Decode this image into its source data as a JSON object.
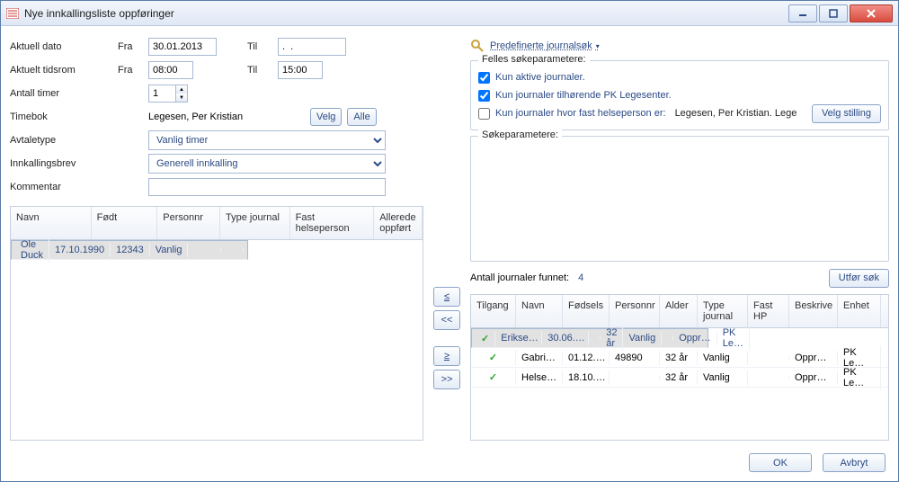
{
  "window": {
    "title": "Nye innkallingsliste oppføringer"
  },
  "form": {
    "aktuell_dato_label": "Aktuell dato",
    "aktuell_tidsrom_label": "Aktuelt tidsrom",
    "antall_timer_label": "Antall timer",
    "timebok_label": "Timebok",
    "avtaletype_label": "Avtaletype",
    "innkallingsbrev_label": "Innkallingsbrev",
    "kommentar_label": "Kommentar",
    "fra_label": "Fra",
    "til_label": "Til",
    "dato_fra": "30.01.2013",
    "dato_til": ".  .",
    "tid_fra": "08:00",
    "tid_til": "15:00",
    "antall_timer": "1",
    "timebok_value": "Legesen, Per Kristian",
    "velg_btn": "Velg",
    "alle_btn": "Alle",
    "avtaletype_value": "Vanlig timer",
    "innkallingsbrev_value": "Generell innkalling",
    "kommentar_value": ""
  },
  "left_table": {
    "headers": {
      "navn": "Navn",
      "fodt": "Født",
      "personnr": "Personnr",
      "type": "Type journal",
      "fastHP": "Fast helseperson",
      "allerede": "Allerede oppført"
    },
    "rows": [
      {
        "navn": "Ole Duck",
        "fodt": "17.10.1990",
        "personnr": "12343",
        "type": "Vanlig",
        "fastHP": "",
        "allerede": ""
      }
    ]
  },
  "mid": {
    "lt": "≤",
    "dlt": "<<",
    "gt": "≥",
    "dgt": ">>"
  },
  "search": {
    "predef_label": "Predefinerte journalsøk",
    "felles_legend": "Felles søkeparametere:",
    "chk_aktive": "Kun aktive journaler.",
    "chk_pk": "Kun journaler tilhørende PK Legesenter.",
    "chk_fast": "Kun journaler hvor fast helseperson er:",
    "fast_person": "Legesen, Per Kristian. Lege",
    "velg_stilling_btn": "Velg stilling",
    "sokeparam_legend": "Søkeparametere:",
    "antall_label": "Antall journaler funnet:",
    "antall_value": "4",
    "utfor_btn": "Utfør søk"
  },
  "results": {
    "headers": {
      "tilgang": "Tilgang",
      "navn": "Navn",
      "fodsels": "Fødsels",
      "personnr": "Personnr",
      "alder": "Alder",
      "type": "Type journal",
      "fastHP": "Fast HP",
      "beskriv": "Beskrive",
      "enhet": "Enhet"
    },
    "rows": [
      {
        "tilgang": "✓",
        "navn": "Erikse…",
        "fodsels": "30.06.…",
        "personnr": "",
        "alder": "32 år",
        "type": "Vanlig",
        "fastHP": "",
        "beskriv": "Oppr…",
        "enhet": "PK Le…"
      },
      {
        "tilgang": "✓",
        "navn": "Gabri…",
        "fodsels": "01.12.…",
        "personnr": "49890",
        "alder": "32 år",
        "type": "Vanlig",
        "fastHP": "",
        "beskriv": "Oppr…",
        "enhet": "PK Le…"
      },
      {
        "tilgang": "✓",
        "navn": "Helse…",
        "fodsels": "18.10.…",
        "personnr": "",
        "alder": "32 år",
        "type": "Vanlig",
        "fastHP": "",
        "beskriv": "Oppr…",
        "enhet": "PK Le…"
      }
    ]
  },
  "footer": {
    "ok": "OK",
    "avbryt": "Avbryt"
  }
}
